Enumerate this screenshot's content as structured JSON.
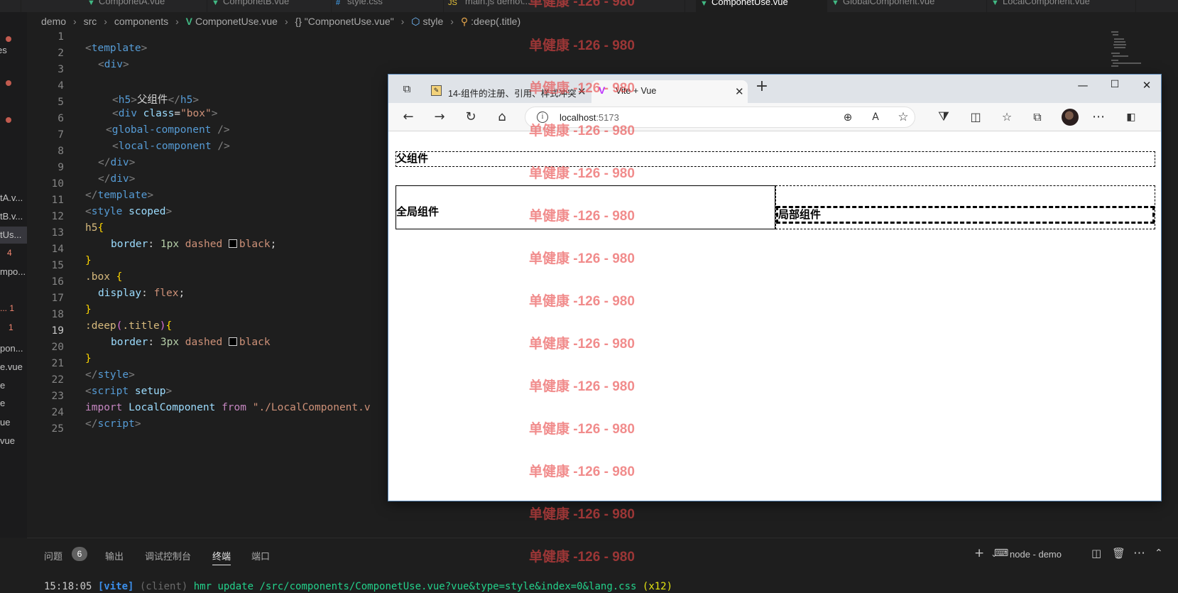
{
  "editor_tabs": [
    {
      "label": "ComponetA.vue",
      "icon": "vue-icon",
      "active": false
    },
    {
      "label": "ComponetB.vue",
      "icon": "vue-icon",
      "active": false
    },
    {
      "label": "style.css",
      "icon": "css-icon",
      "active": false
    },
    {
      "label": "main.js demo\\...",
      "icon": "js-icon",
      "active": false
    },
    {
      "label": "ComponetUse.vue",
      "icon": "vue-icon",
      "active": true
    },
    {
      "label": "GlobalComponent.vue",
      "icon": "vue-icon",
      "active": false
    },
    {
      "label": "LocalComponent.vue",
      "icon": "vue-icon",
      "active": false
    }
  ],
  "explorer_items": [
    "tA.v...",
    "tB.v...",
    "tUs...",
    "4",
    "mpo...",
    "... 1",
    "1",
    "pon...",
    "e.vue",
    "e",
    "e",
    "ue",
    "vue"
  ],
  "breadcrumb": [
    "demo",
    "src",
    "components",
    "ComponetUse.vue",
    "{} \"ComponetUse.vue\"",
    "style",
    ":deep(.title)"
  ],
  "code_lines": [
    {
      "n": "1"
    },
    {
      "n": "2"
    },
    {
      "n": "3"
    },
    {
      "n": "4"
    },
    {
      "n": "5"
    },
    {
      "n": "6"
    },
    {
      "n": "7"
    },
    {
      "n": "8"
    },
    {
      "n": "9"
    },
    {
      "n": "10"
    },
    {
      "n": "11"
    },
    {
      "n": "12"
    },
    {
      "n": "13"
    },
    {
      "n": "14"
    },
    {
      "n": "15"
    },
    {
      "n": "16"
    },
    {
      "n": "17"
    },
    {
      "n": "18"
    },
    {
      "n": "19"
    },
    {
      "n": "20"
    },
    {
      "n": "21"
    },
    {
      "n": "22"
    },
    {
      "n": "23"
    },
    {
      "n": "24"
    },
    {
      "n": "25"
    }
  ],
  "code": {
    "l1": {
      "open": "<",
      "tag": "template",
      "close": ">"
    },
    "l2": {
      "open": "<",
      "tag": "div",
      "close": ">"
    },
    "l4": {
      "open": "<",
      "tag": "h5",
      "close": ">",
      "text": "父组件",
      "end_open": "</",
      "end_tag": "h5",
      "end_close": ">"
    },
    "l5": {
      "open": "<",
      "tag": "div",
      "attr": "class",
      "eq": "=",
      "val": "\"box\"",
      "close": ">"
    },
    "l6": {
      "open": "<",
      "tag": "global-component",
      "close": " />"
    },
    "l7": {
      "open": "<",
      "tag": "local-component",
      "close": " />"
    },
    "l8": {
      "open": "</",
      "tag": "div",
      "close": ">"
    },
    "l9": {
      "open": "</",
      "tag": "div",
      "close": ">"
    },
    "l10": {
      "open": "</",
      "tag": "template",
      "close": ">"
    },
    "l11": {
      "open": "<",
      "tag": "style",
      "attr": " scoped",
      "close": ">"
    },
    "l12": {
      "sel": "h5",
      "brace": "{"
    },
    "l13": {
      "prop": "border",
      "colon": ": ",
      "num": "1px",
      "val": " dashed ",
      "color": "black",
      "semi": ";"
    },
    "l14": {
      "brace": "}"
    },
    "l15": {
      "sel": ".box ",
      "brace": "{"
    },
    "l16": {
      "prop": "display",
      "colon": ": ",
      "val": "flex",
      "semi": ";"
    },
    "l17": {
      "brace": "}"
    },
    "l18": {
      "sel": ":deep",
      "paren_open": "(",
      "inner": ".title",
      "paren_close": ")",
      "brace": "{"
    },
    "l19": {
      "prop": "border",
      "colon": ": ",
      "num": "3px",
      "val": " dashed ",
      "color": "black"
    },
    "l20": {
      "brace": "}"
    },
    "l21": {
      "open": "</",
      "tag": "style",
      "close": ">"
    },
    "l22": {
      "open": "<",
      "tag": "script",
      "attr": " setup",
      "close": ">"
    },
    "l23": {
      "kw": "import",
      "id": " LocalComponent ",
      "kw2": "from",
      "str": " \"./LocalComponent.v"
    },
    "l24": {
      "open": "</",
      "tag": "script",
      "close": ">"
    }
  },
  "panel": {
    "tabs": [
      "问题",
      "输出",
      "调试控制台",
      "终端",
      "端口"
    ],
    "problems_count": "6",
    "active_tab": "终端",
    "terminal_name": "node - demo",
    "terminal_line": {
      "time": "15:18:05 ",
      "tag": "[vite]",
      "client": " (client) ",
      "msg": "hmr update /src/components/ComponetUse.vue?vue&type=style&index=0&lang.css",
      "count": " (x12)"
    }
  },
  "browser": {
    "tabs": [
      {
        "label": "14-组件的注册、引用、样式冲突",
        "active": false
      },
      {
        "label": "Vite + Vue",
        "active": true
      }
    ],
    "url_host": "localhost",
    "url_port": ":5173",
    "page": {
      "parent_title": "父组件",
      "global_title": "全局组件",
      "local_title": "局部组件"
    }
  },
  "watermark_text": "单健康 -126 - 980",
  "colors": {
    "vue": "#41b883",
    "editor_bg": "#1e1e1e",
    "watermark": "#e84646"
  }
}
